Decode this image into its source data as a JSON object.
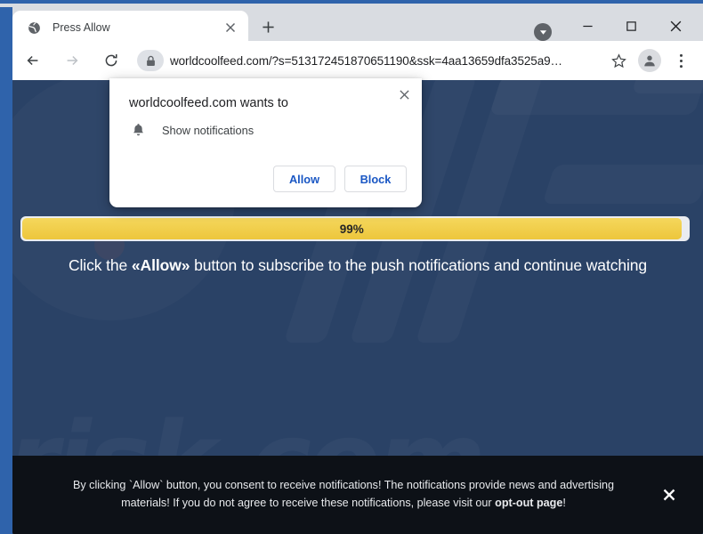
{
  "window": {
    "controls": {
      "extra_icon": "chevron-down-circle-icon",
      "minimize_glyph": "–",
      "maximize_glyph": "□",
      "close_glyph": "✕"
    }
  },
  "tabstrip": {
    "tab": {
      "favicon": "globe-icon",
      "title": "Press Allow",
      "close_glyph": "✕"
    },
    "new_tab_glyph": "+"
  },
  "toolbar": {
    "back_icon": "arrow-left-icon",
    "forward_icon": "arrow-right-icon",
    "reload_icon": "reload-icon",
    "lock_icon": "lock-icon",
    "url": "worldcoolfeed.com/?s=513172451870651190&ssk=4aa13659dfa3525a9…",
    "star_icon": "star-icon",
    "profile_icon": "profile-avatar-icon",
    "menu_icon": "three-dot-menu-icon"
  },
  "permission_dialog": {
    "title": "worldcoolfeed.com wants to",
    "permission_icon": "bell-icon",
    "permission_label": "Show notifications",
    "allow_label": "Allow",
    "block_label": "Block",
    "close_glyph": "✕",
    "accent_color": "#1a57c4"
  },
  "page": {
    "watermark_text": "risk.com",
    "background_color": "#2a4266",
    "progress": {
      "percent_label": "99%",
      "percent_value": 99,
      "fill_color": "#edc63c"
    },
    "instruction": {
      "before": "Click the ",
      "highlight": "«Allow»",
      "after": " button to subscribe to the push notifications and continue watching"
    },
    "consent_banner": {
      "line1": "By clicking `Allow` button, you consent to receive notifications! The notifications provide news and advertising",
      "line2_before": "materials! If you do not agree to receive these notifications, please visit our ",
      "line2_link": "opt-out page",
      "line2_after": "!",
      "close_glyph": "✕",
      "background_color": "#0d1117"
    }
  }
}
